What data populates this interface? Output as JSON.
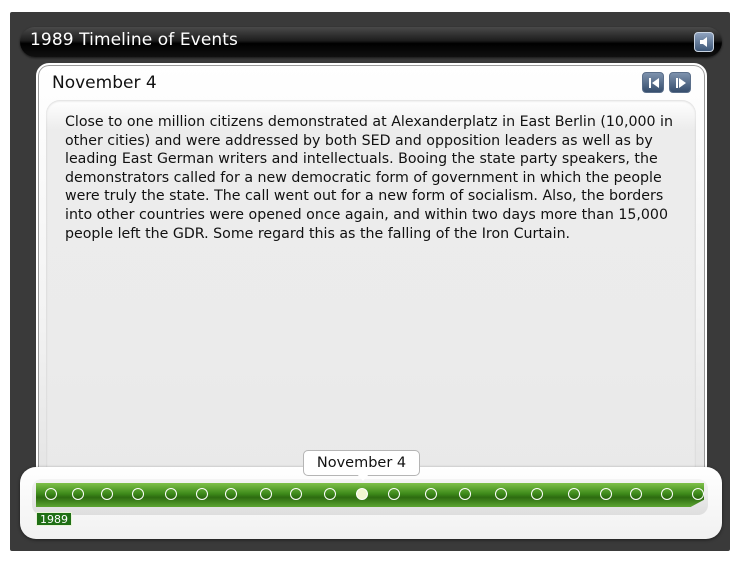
{
  "window": {
    "title": "1989 Timeline of Events"
  },
  "icons": {
    "audio": "speaker-icon",
    "prev": "previous-arrow-icon",
    "next": "next-arrow-icon"
  },
  "event": {
    "date": "November 4",
    "text": "Close to one million citizens demonstrated at Alexanderplatz in East Berlin (10,000 in other cities) and were addressed by both SED and opposition leaders as well as by leading East German writers and intellectuals. Booing the state party speakers, the demonstrators called for a new democratic form of government in which the people were truly the state. The call went out for a new form of socialism. Also, the borders into other countries were opened once again, and within two days more than 15,000 people left the GDR. Some regard this as the falling of the Iron Curtain."
  },
  "timeline": {
    "year": "1989",
    "callout": "November 4",
    "dot_count": 21,
    "active_index": 10,
    "colors": {
      "track": "#3d8a1a",
      "year_badge": "#1f6f15"
    }
  }
}
